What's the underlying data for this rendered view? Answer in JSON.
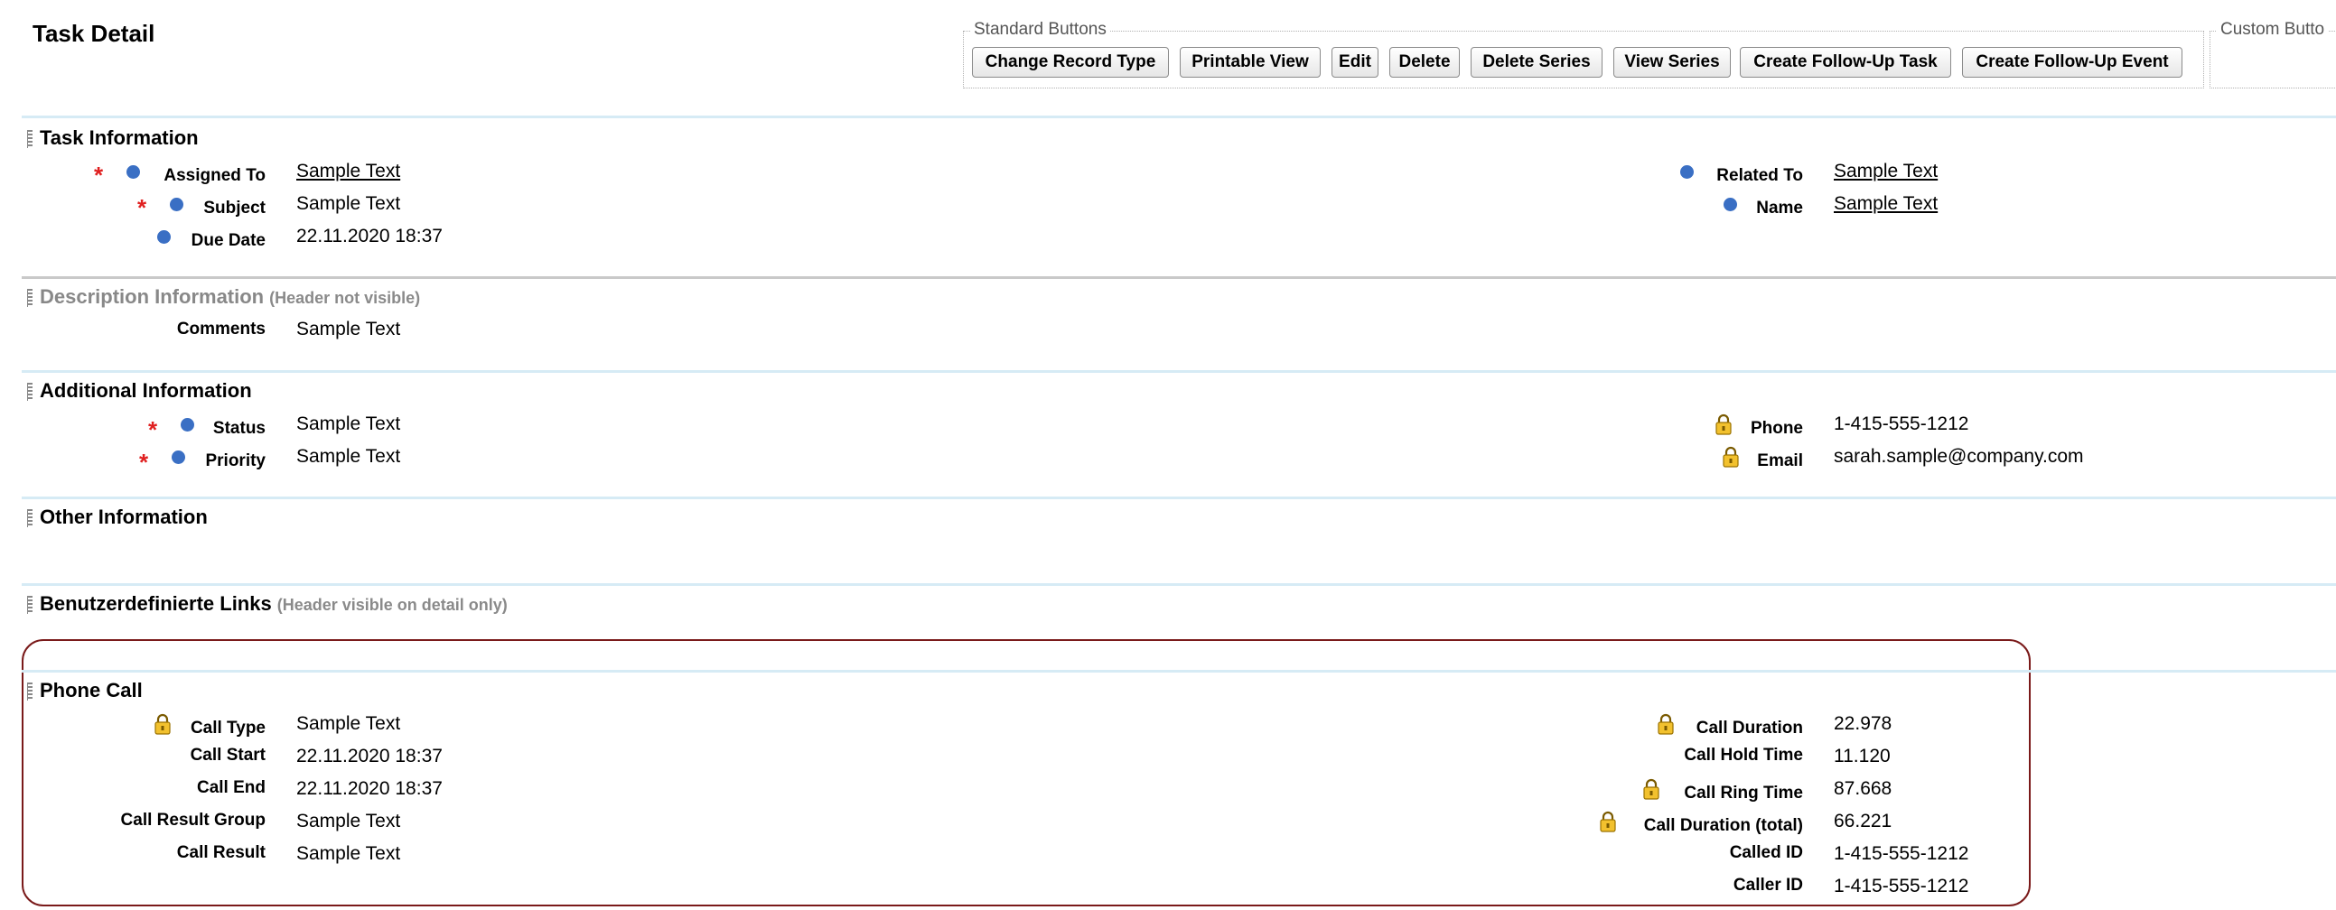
{
  "page": {
    "title": "Task Detail"
  },
  "toolbar": {
    "standard_legend": "Standard Buttons",
    "custom_legend": "Custom Butto",
    "buttons": {
      "change_record_type": "Change Record Type",
      "printable_view": "Printable View",
      "edit": "Edit",
      "delete": "Delete",
      "delete_series": "Delete Series",
      "view_series": "View Series",
      "create_follow_up_task": "Create Follow-Up Task",
      "create_follow_up_event": "Create Follow-Up Event"
    }
  },
  "sections": {
    "task_information": {
      "title": "Task Information",
      "assigned_to": {
        "label": "Assigned To",
        "value": "Sample Text"
      },
      "subject": {
        "label": "Subject",
        "value": "Sample Text"
      },
      "due_date": {
        "label": "Due Date",
        "value": "22.11.2020 18:37"
      },
      "related_to": {
        "label": "Related To",
        "value": "Sample Text"
      },
      "name": {
        "label": "Name",
        "value": "Sample Text"
      }
    },
    "description_information": {
      "title": "Description Information",
      "note": "(Header not visible)",
      "comments": {
        "label": "Comments",
        "value": "Sample Text"
      }
    },
    "additional_information": {
      "title": "Additional Information",
      "status": {
        "label": "Status",
        "value": "Sample Text"
      },
      "priority": {
        "label": "Priority",
        "value": "Sample Text"
      },
      "phone": {
        "label": "Phone",
        "value": "1-415-555-1212"
      },
      "email": {
        "label": "Email",
        "value": "sarah.sample@company.com"
      }
    },
    "other_information": {
      "title": "Other Information"
    },
    "custom_links": {
      "title": "Benutzerdefinierte Links",
      "note": "(Header visible on detail only)"
    },
    "phone_call": {
      "title": "Phone Call",
      "call_type": {
        "label": "Call Type",
        "value": "Sample Text"
      },
      "call_start": {
        "label": "Call Start",
        "value": "22.11.2020 18:37"
      },
      "call_end": {
        "label": "Call End",
        "value": "22.11.2020 18:37"
      },
      "call_result_group": {
        "label": "Call Result Group",
        "value": "Sample Text"
      },
      "call_result": {
        "label": "Call Result",
        "value": "Sample Text"
      },
      "call_duration": {
        "label": "Call Duration",
        "value": "22.978"
      },
      "call_hold_time": {
        "label": "Call Hold Time",
        "value": "11.120"
      },
      "call_ring_time": {
        "label": "Call Ring Time",
        "value": "87.668"
      },
      "call_duration_total": {
        "label": "Call Duration (total)",
        "value": "66.221"
      },
      "called_id": {
        "label": "Called ID",
        "value": "1-415-555-1212"
      },
      "caller_id": {
        "label": "Caller ID",
        "value": "1-415-555-1212"
      }
    }
  },
  "colors": {
    "required": "#e02020",
    "dot": "#3a6fc4",
    "section_rule": "#d6ebf5",
    "highlight": "#7a1a1a"
  },
  "icons": {
    "required": "required-asterisk-icon",
    "dot": "field-dot-icon",
    "lock": "lock-icon"
  }
}
